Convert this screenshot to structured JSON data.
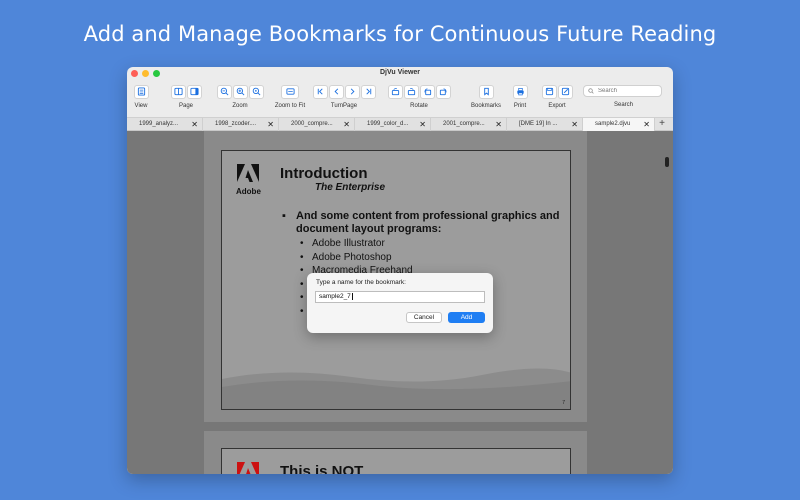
{
  "headline": "Add and Manage Bookmarks for Continuous Future Reading",
  "window": {
    "title": "DjVu Viewer"
  },
  "toolbar": {
    "view": "View",
    "page": "Page",
    "zoom": "Zoom",
    "zoom_to_fit": "Zoom to Fit",
    "turn_page": "TurnPage",
    "rotate": "Rotate",
    "bookmarks": "Bookmarks",
    "print": "Print",
    "export": "Export",
    "search_label": "Search",
    "search_placeholder": "Search"
  },
  "tabs": [
    {
      "label": "1999_analyz..."
    },
    {
      "label": "1998_zcoder...."
    },
    {
      "label": "2000_compre..."
    },
    {
      "label": "1999_color_d..."
    },
    {
      "label": "2001_compre..."
    },
    {
      "label": "[DME 19] In ..."
    },
    {
      "label": "sample2.djvu"
    }
  ],
  "tab_close": "✕",
  "tab_add": "+",
  "document": {
    "logo_text": "Adobe",
    "title": "Introduction",
    "subtitle": "The Enterprise",
    "bullet_marker": "▪",
    "bullet": "And some content from professional graphics and document layout programs:",
    "sub_marker": "•",
    "sub_items": [
      "Adobe Illustrator",
      "Adobe Photoshop",
      "Macromedia Freehand"
    ],
    "page_number": "7"
  },
  "page2": {
    "title_partial": "This is NOT"
  },
  "dialog": {
    "label": "Type a name for the bookmark:",
    "value": "sample2_7",
    "cancel": "Cancel",
    "add": "Add"
  },
  "colors": {
    "background": "#4f86d9",
    "accent": "#1f7ef3",
    "adobe_red": "#cc1111"
  }
}
